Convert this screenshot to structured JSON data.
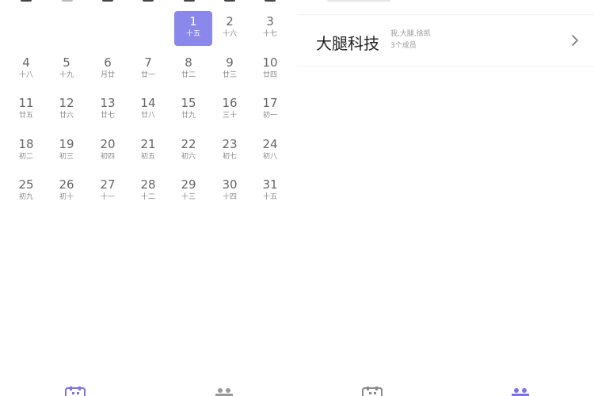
{
  "calendar": {
    "cells": [
      {
        "day": "1",
        "lunar": "十五",
        "selected": true
      },
      {
        "day": "2",
        "lunar": "十六"
      },
      {
        "day": "3",
        "lunar": "十七"
      },
      {
        "day": "4",
        "lunar": "十八"
      },
      {
        "day": "5",
        "lunar": "十九"
      },
      {
        "day": "6",
        "lunar": "月廿"
      },
      {
        "day": "7",
        "lunar": "廿一"
      },
      {
        "day": "8",
        "lunar": "廿二"
      },
      {
        "day": "9",
        "lunar": "廿三"
      },
      {
        "day": "10",
        "lunar": "廿四"
      },
      {
        "day": "11",
        "lunar": "廿五"
      },
      {
        "day": "12",
        "lunar": "廿六"
      },
      {
        "day": "13",
        "lunar": "廿七"
      },
      {
        "day": "14",
        "lunar": "廿八"
      },
      {
        "day": "15",
        "lunar": "廿九"
      },
      {
        "day": "16",
        "lunar": "三十"
      },
      {
        "day": "17",
        "lunar": "初一"
      },
      {
        "day": "18",
        "lunar": "初二"
      },
      {
        "day": "19",
        "lunar": "初三"
      },
      {
        "day": "20",
        "lunar": "初四"
      },
      {
        "day": "21",
        "lunar": "初五"
      },
      {
        "day": "22",
        "lunar": "初六"
      },
      {
        "day": "23",
        "lunar": "初七"
      },
      {
        "day": "24",
        "lunar": "初八"
      },
      {
        "day": "25",
        "lunar": "初九"
      },
      {
        "day": "26",
        "lunar": "初十"
      },
      {
        "day": "27",
        "lunar": "十一"
      },
      {
        "day": "28",
        "lunar": "十二"
      },
      {
        "day": "29",
        "lunar": "十三"
      },
      {
        "day": "30",
        "lunar": "十四"
      },
      {
        "day": "31",
        "lunar": "十五"
      }
    ]
  },
  "group": {
    "name": "大腿科技",
    "members": "我,大腿,徐凯",
    "count": "3个成员"
  },
  "colors": {
    "selected": "#8a88ea",
    "tab_accent": "#7b74e6"
  },
  "icons": {
    "chevron": "chevron-right-icon",
    "tabs": [
      "calendar-tab-icon",
      "group-tab-icon",
      "calendar-tab-icon",
      "group-tab-icon"
    ]
  }
}
